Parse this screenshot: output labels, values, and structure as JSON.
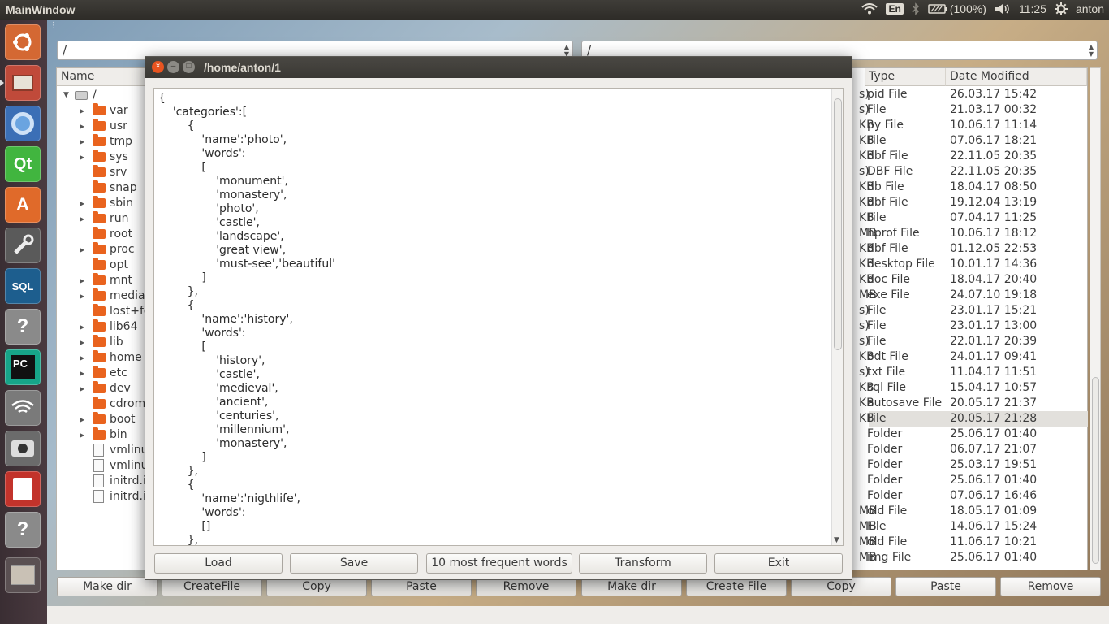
{
  "topbar": {
    "title": "MainWindow",
    "keyboard": "En",
    "battery": "(100%)",
    "time": "11:25",
    "user": "anton"
  },
  "launcher": {
    "items": [
      "ubuntu-dash",
      "file-manager",
      "chromium",
      "qt-creator",
      "software-center",
      "system-settings",
      "mysql-workbench",
      "unknown-app",
      "pycharm",
      "network",
      "screenshot",
      "text-editor",
      "unknown-app",
      "workspace-switcher"
    ]
  },
  "left_panel": {
    "path": "/",
    "column_name": "Name",
    "root": "/",
    "tree": [
      {
        "name": "var",
        "type": "folder",
        "expandable": true
      },
      {
        "name": "usr",
        "type": "folder",
        "expandable": true
      },
      {
        "name": "tmp",
        "type": "folder",
        "expandable": true
      },
      {
        "name": "sys",
        "type": "folder",
        "expandable": true
      },
      {
        "name": "srv",
        "type": "folder",
        "expandable": false
      },
      {
        "name": "snap",
        "type": "folder",
        "expandable": false
      },
      {
        "name": "sbin",
        "type": "folder",
        "expandable": true
      },
      {
        "name": "run",
        "type": "folder",
        "expandable": true
      },
      {
        "name": "root",
        "type": "folder",
        "expandable": false
      },
      {
        "name": "proc",
        "type": "folder",
        "expandable": true
      },
      {
        "name": "opt",
        "type": "folder",
        "expandable": false
      },
      {
        "name": "mnt",
        "type": "folder",
        "expandable": true
      },
      {
        "name": "media",
        "type": "folder",
        "expandable": true
      },
      {
        "name": "lost+fo",
        "type": "folder",
        "expandable": false
      },
      {
        "name": "lib64",
        "type": "folder",
        "expandable": true
      },
      {
        "name": "lib",
        "type": "folder",
        "expandable": true
      },
      {
        "name": "home",
        "type": "folder",
        "expandable": true
      },
      {
        "name": "etc",
        "type": "folder",
        "expandable": true
      },
      {
        "name": "dev",
        "type": "folder",
        "expandable": true
      },
      {
        "name": "cdrom",
        "type": "folder",
        "expandable": false
      },
      {
        "name": "boot",
        "type": "folder",
        "expandable": true
      },
      {
        "name": "bin",
        "type": "folder",
        "expandable": true
      },
      {
        "name": "vmlinu",
        "type": "file",
        "expandable": false
      },
      {
        "name": "vmlinu",
        "type": "file",
        "expandable": false
      },
      {
        "name": "initrd.i",
        "type": "file",
        "expandable": false
      },
      {
        "name": "initrd.i",
        "type": "file",
        "expandable": false
      }
    ],
    "buttons": [
      "Make dir",
      "CreateFile",
      "Copy",
      "Paste",
      "Remove"
    ]
  },
  "right_panel": {
    "path": "/",
    "columns": [
      "Type",
      "Date Modified"
    ],
    "rows": [
      {
        "size_tail": "s)",
        "type": "pid File",
        "date": "26.03.17 15:42"
      },
      {
        "size_tail": "s)",
        "type": "File",
        "date": "21.03.17 00:32"
      },
      {
        "size_tail": "KB",
        "type": "py File",
        "date": "10.06.17 11:14"
      },
      {
        "size_tail": "KB",
        "type": "File",
        "date": "07.06.17 18:21"
      },
      {
        "size_tail": "KB",
        "type": "dbf File",
        "date": "22.11.05 20:35"
      },
      {
        "size_tail": "s)",
        "type": "DBF File",
        "date": "22.11.05 20:35"
      },
      {
        "size_tail": "KB",
        "type": "db File",
        "date": "18.04.17 08:50"
      },
      {
        "size_tail": "KB",
        "type": "dbf File",
        "date": "19.12.04 13:19"
      },
      {
        "size_tail": "KB",
        "type": "File",
        "date": "07.04.17 11:25"
      },
      {
        "size_tail": "MB",
        "type": "hprof File",
        "date": "10.06.17 18:12"
      },
      {
        "size_tail": "KB",
        "type": "dbf File",
        "date": "01.12.05 22:53"
      },
      {
        "size_tail": "KB",
        "type": "desktop File",
        "date": "10.01.17 14:36"
      },
      {
        "size_tail": "KB",
        "type": "doc File",
        "date": "18.04.17 20:40"
      },
      {
        "size_tail": "MB",
        "type": "exe File",
        "date": "24.07.10 19:18"
      },
      {
        "size_tail": "s)",
        "type": "File",
        "date": "23.01.17 15:21"
      },
      {
        "size_tail": "s)",
        "type": "File",
        "date": "23.01.17 13:00"
      },
      {
        "size_tail": "s)",
        "type": "File",
        "date": "22.01.17 20:39"
      },
      {
        "size_tail": "KB",
        "type": "odt File",
        "date": "24.01.17 09:41"
      },
      {
        "size_tail": "s)",
        "type": "txt File",
        "date": "11.04.17 11:51"
      },
      {
        "size_tail": "KB",
        "type": "sql File",
        "date": "15.04.17 10:57"
      },
      {
        "size_tail": "KB",
        "type": "autosave File",
        "date": "20.05.17 21:37"
      },
      {
        "size_tail": "KB",
        "type": "File",
        "date": "20.05.17 21:28",
        "selected": true
      },
      {
        "size_tail": "",
        "type": "Folder",
        "date": "25.06.17 01:40"
      },
      {
        "size_tail": "",
        "type": "Folder",
        "date": "06.07.17 21:07"
      },
      {
        "size_tail": "",
        "type": "Folder",
        "date": "25.03.17 19:51"
      },
      {
        "size_tail": "",
        "type": "Folder",
        "date": "25.06.17 01:40"
      },
      {
        "size_tail": "",
        "type": "Folder",
        "date": "07.06.17 16:46"
      },
      {
        "size_tail": "MB",
        "type": "old File",
        "date": "18.05.17 01:09"
      },
      {
        "size_tail": "MB",
        "type": "File",
        "date": "14.06.17 15:24"
      },
      {
        "size_tail": "MB",
        "type": "old File",
        "date": "11.06.17 10:21"
      },
      {
        "size_tail": "MB",
        "type": "img File",
        "date": "25.06.17 01:40"
      }
    ],
    "buttons": [
      "Make dir",
      "Create File",
      "Copy",
      "Paste",
      "Remove"
    ]
  },
  "dialog": {
    "title": "/home/anton/1",
    "content": "{\n\t'categories':[\n\t\t{\n\t\t\t'name':'photo',\n\t\t\t'words':\n\t\t\t[\n\t\t\t\t'monument',\n\t\t\t\t'monastery',\n\t\t\t\t'photo',\n\t\t\t\t'castle',\n\t\t\t\t'landscape',\n\t\t\t\t'great view',\n\t\t\t\t'must-see','beautiful'\n\t\t\t]\n\t\t},\n\t\t{\n\t\t\t'name':'history',\n\t\t\t'words':\n\t\t\t[\n\t\t\t\t'history',\n\t\t\t\t'castle',\n\t\t\t\t'medieval',\n\t\t\t\t'ancient',\n\t\t\t\t'centuries',\n\t\t\t\t'millennium',\n\t\t\t\t'monastery',\n\t\t\t]\n\t\t},\n\t\t{\n\t\t\t'name':'nigthlife',\n\t\t\t'words':\n\t\t\t[]\n\t\t},",
    "buttons": {
      "load": "Load",
      "save": "Save",
      "frequent": "10 most frequent words",
      "transform": "Transform",
      "exit": "Exit"
    }
  },
  "colors": {
    "accent_close": "#e95420",
    "panel_bg": "#efedea",
    "topbar": "#3c3b37"
  }
}
